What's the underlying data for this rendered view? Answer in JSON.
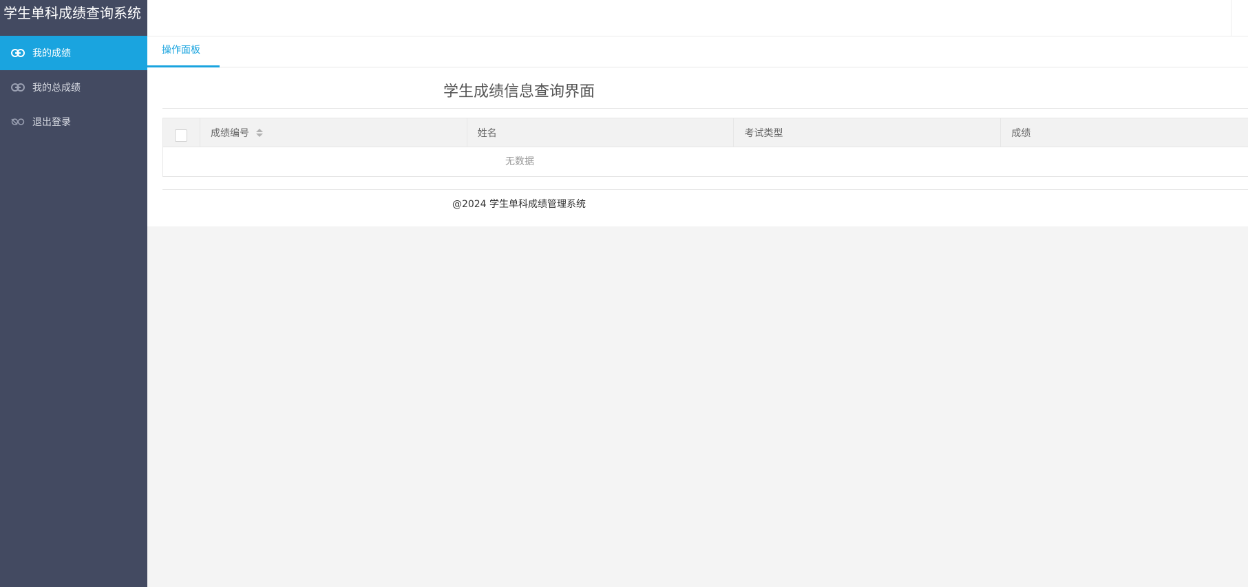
{
  "app": {
    "title": "学生单科成绩查询系统"
  },
  "sidebar": {
    "items": [
      {
        "label": "我的成绩",
        "icon": "link-icon",
        "active": true
      },
      {
        "label": "我的总成绩",
        "icon": "link-icon",
        "active": false
      },
      {
        "label": "退出登录",
        "icon": "logout-icon",
        "active": false
      }
    ]
  },
  "tabs": [
    {
      "label": "操作面板",
      "active": true
    }
  ],
  "page": {
    "title": "学生成绩信息查询界面"
  },
  "table": {
    "columns": [
      "成绩编号",
      "姓名",
      "考试类型",
      "成绩"
    ],
    "empty_text": "无数据"
  },
  "footer": {
    "text": "@2024 学生单科成绩管理系统"
  },
  "colors": {
    "sidebar_bg": "#434a61",
    "accent": "#1aa4df"
  }
}
